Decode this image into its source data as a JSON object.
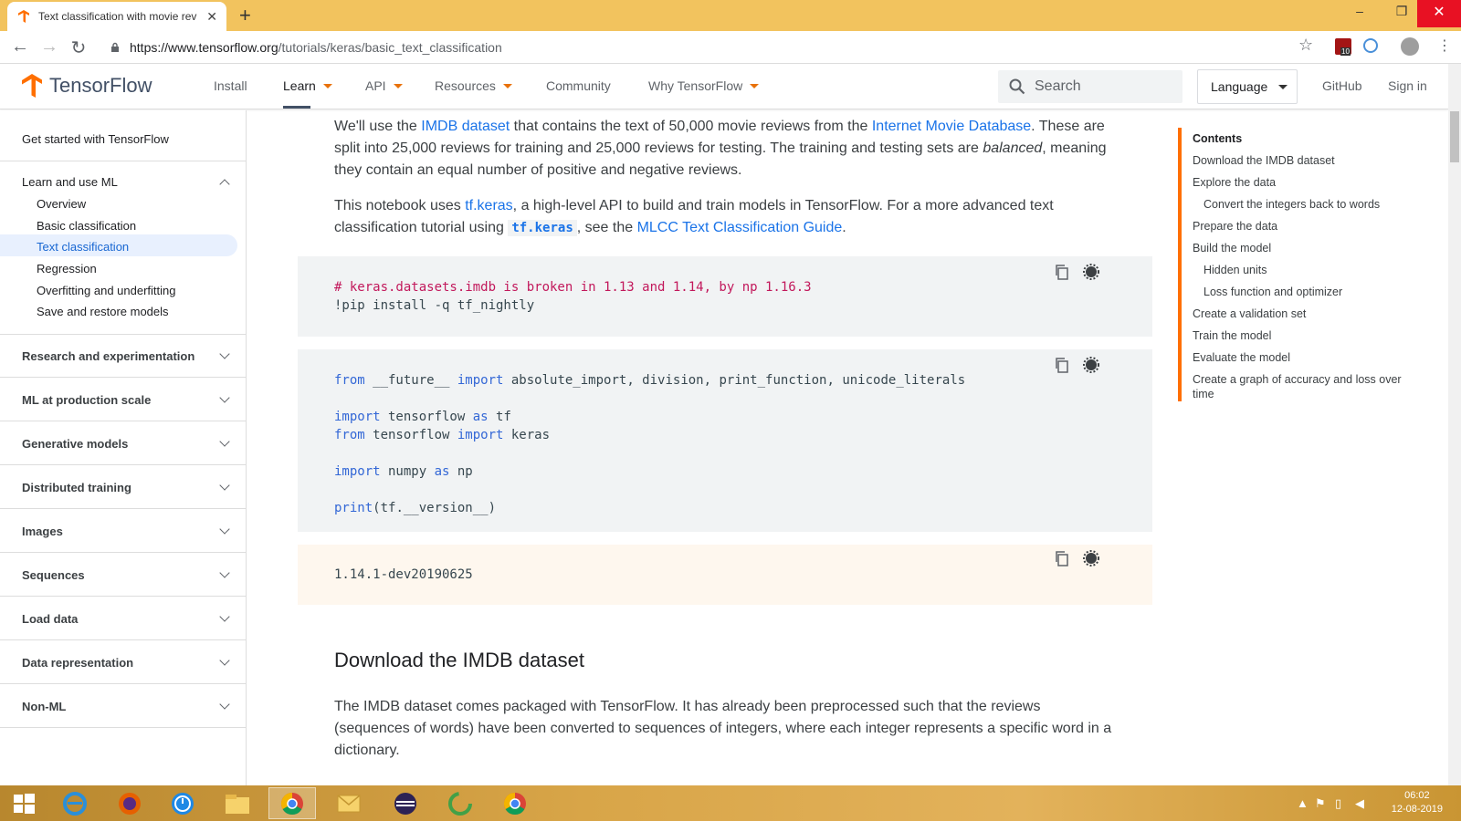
{
  "browser": {
    "tab_title": "Text classification with movie rev",
    "url_host": "https://www.tensorflow.org",
    "url_path": "/tutorials/keras/basic_text_classification",
    "ext_badge": "10"
  },
  "header": {
    "brand": "TensorFlow",
    "nav": [
      "Install",
      "Learn",
      "API",
      "Resources",
      "Community",
      "Why TensorFlow"
    ],
    "search_placeholder": "Search",
    "language": "Language",
    "github": "GitHub",
    "signin": "Sign in"
  },
  "sidebar": {
    "get_started": "Get started with TensorFlow",
    "learn_section": "Learn and use ML",
    "learn_items": [
      "Overview",
      "Basic classification",
      "Text classification",
      "Regression",
      "Overfitting and underfitting",
      "Save and restore models"
    ],
    "sections": [
      "Research and experimentation",
      "ML at production scale",
      "Generative models",
      "Distributed training",
      "Images",
      "Sequences",
      "Load data",
      "Data representation",
      "Non-ML"
    ]
  },
  "content": {
    "p1": {
      "a": "We'll use the ",
      "link1": "IMDB dataset",
      "b": " that contains the text of 50,000 movie reviews from the ",
      "link2": "Internet Movie Database",
      "c": ". These are split into 25,000 reviews for training and 25,000 reviews for testing. The training and testing sets are ",
      "em": "balanced",
      "d": ", meaning they contain an equal number of positive and negative reviews."
    },
    "p2": {
      "a": "This notebook uses ",
      "link1": "tf.keras",
      "b": ", a high-level API to build and train models in TensorFlow. For a more advanced text classification tutorial using ",
      "code": "tf.keras",
      "c": ", see the ",
      "link2": "MLCC Text Classification Guide",
      "d": "."
    },
    "code1": {
      "comment": "# keras.datasets.imdb is broken in 1.13 and 1.14, by np 1.16.3",
      "line2": "!pip install -q tf_nightly"
    },
    "code2": {
      "l1_kw1": "from",
      "l1_mid": " __future__ ",
      "l1_kw2": "import",
      "l1_rest": " absolute_import, division, print_function, unicode_literals",
      "l2_kw1": "import",
      "l2_mid": " tensorflow ",
      "l2_kw2": "as",
      "l2_rest": " tf",
      "l3_kw1": "from",
      "l3_mid": " tensorflow ",
      "l3_kw2": "import",
      "l3_rest": " keras",
      "l4_kw1": "import",
      "l4_mid": " numpy ",
      "l4_kw2": "as",
      "l4_rest": " np",
      "l5_kw": "print",
      "l5_rest": "(tf.__version__)"
    },
    "output": "1.14.1-dev20190625",
    "heading": "Download the IMDB dataset",
    "p3": "The IMDB dataset comes packaged with TensorFlow. It has already been preprocessed such that the reviews (sequences of words) have been converted to sequences of integers, where each integer represents a specific word in a dictionary."
  },
  "toc": {
    "title": "Contents",
    "items": [
      {
        "label": "Download the IMDB dataset",
        "level": 1
      },
      {
        "label": "Explore the data",
        "level": 1
      },
      {
        "label": "Convert the integers back to words",
        "level": 2
      },
      {
        "label": "Prepare the data",
        "level": 1
      },
      {
        "label": "Build the model",
        "level": 1
      },
      {
        "label": "Hidden units",
        "level": 2
      },
      {
        "label": "Loss function and optimizer",
        "level": 2
      },
      {
        "label": "Create a validation set",
        "level": 1
      },
      {
        "label": "Train the model",
        "level": 1
      },
      {
        "label": "Evaluate the model",
        "level": 1
      },
      {
        "label": "Create a graph of accuracy and loss over time",
        "level": 1
      }
    ]
  },
  "taskbar": {
    "time": "06:02",
    "date": "12-08-2019"
  },
  "colors": {
    "accent_orange": "#ff6f00",
    "link_blue": "#1a73e8",
    "chrome_yellow": "#f2c35e"
  }
}
